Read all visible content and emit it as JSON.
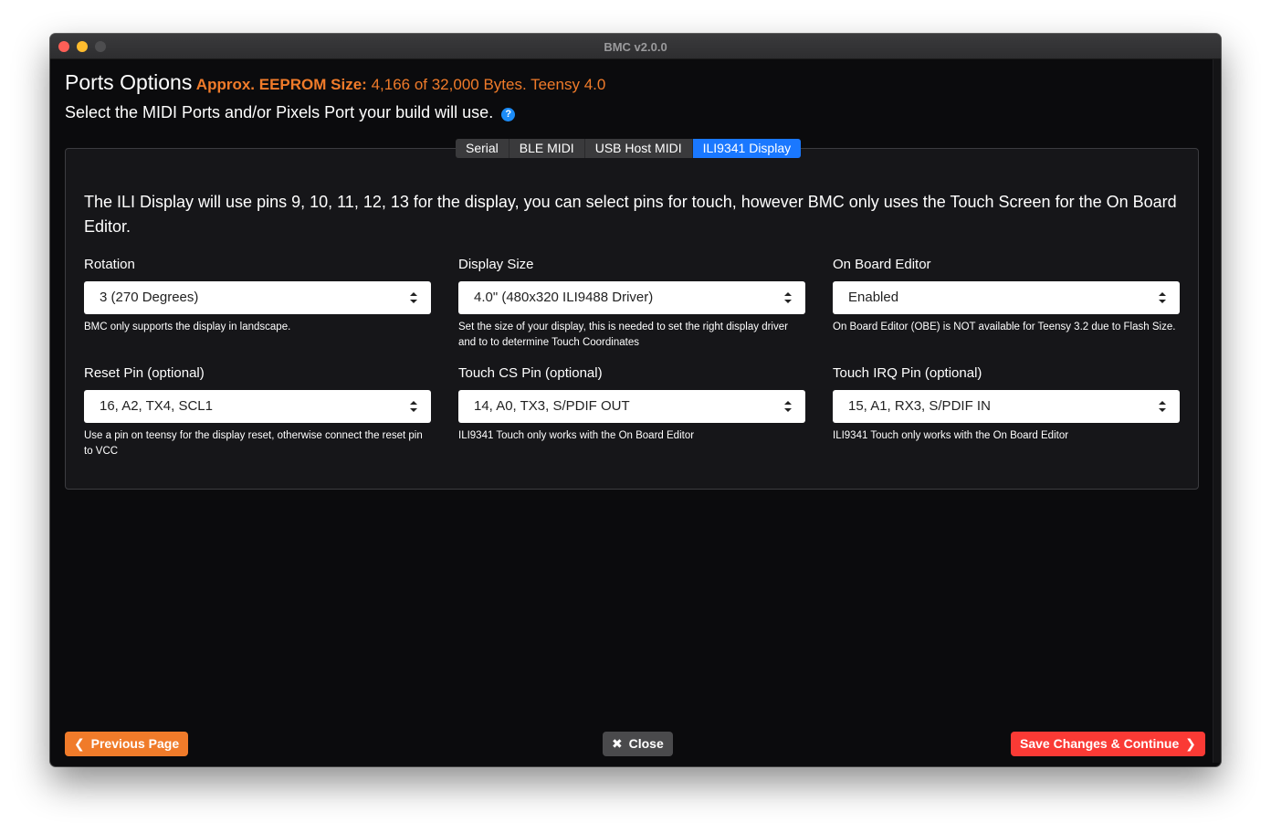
{
  "window": {
    "title": "BMC v2.0.0"
  },
  "header": {
    "title": "Ports Options",
    "eeprom_label": "Approx. EEPROM Size:",
    "eeprom_value": "4,166 of 32,000 Bytes. Teensy 4.0",
    "subtitle": "Select the MIDI Ports and/or Pixels Port your build will use.",
    "help_icon": "question-circle-icon"
  },
  "tabs": [
    {
      "label": "Serial",
      "active": false
    },
    {
      "label": "BLE MIDI",
      "active": false
    },
    {
      "label": "USB Host MIDI",
      "active": false
    },
    {
      "label": "ILI9341 Display",
      "active": true
    }
  ],
  "panel": {
    "intro": "The ILI Display will use pins 9, 10, 11, 12, 13 for the display, you can select pins for touch, however BMC only uses the Touch Screen for the On Board Editor.",
    "fields": [
      {
        "label": "Rotation",
        "value": "3 (270 Degrees)",
        "help": "BMC only supports the display in landscape."
      },
      {
        "label": "Display Size",
        "value": "4.0\" (480x320 ILI9488 Driver)",
        "help": "Set the size of your display, this is needed to set the right display driver and to to determine Touch Coordinates"
      },
      {
        "label": "On Board Editor",
        "value": "Enabled",
        "help": "On Board Editor (OBE) is NOT available for Teensy 3.2 due to Flash Size."
      },
      {
        "label": "Reset Pin (optional)",
        "value": "16, A2, TX4, SCL1",
        "help": "Use a pin on teensy for the display reset, otherwise connect the reset pin to VCC"
      },
      {
        "label": "Touch CS Pin (optional)",
        "value": "14, A0, TX3, S/PDIF OUT",
        "help": "ILI9341 Touch only works with the On Board Editor"
      },
      {
        "label": "Touch IRQ Pin (optional)",
        "value": "15, A1, RX3, S/PDIF IN",
        "help": "ILI9341 Touch only works with the On Board Editor"
      }
    ]
  },
  "footer": {
    "prev_label": "Previous Page",
    "close_label": "Close",
    "save_label": "Save Changes & Continue"
  },
  "colors": {
    "accent_orange": "#f07b2a",
    "tab_active": "#1a78ff",
    "save_red": "#fa3a35",
    "background": "#0b0b0d"
  }
}
